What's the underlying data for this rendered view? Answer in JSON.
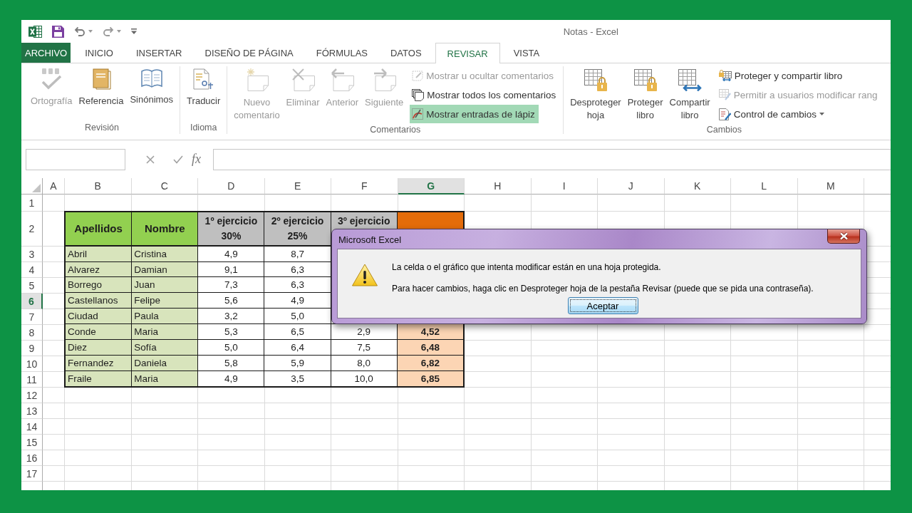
{
  "window": {
    "title": "Notas - Excel"
  },
  "tabs": [
    {
      "label": "ARCHIVO",
      "kind": "backstage",
      "selected": false
    },
    {
      "label": "INICIO",
      "kind": "tab",
      "selected": false
    },
    {
      "label": "INSERTAR",
      "kind": "tab",
      "selected": false
    },
    {
      "label": "DISEÑO DE PÁGINA",
      "kind": "tab",
      "selected": false
    },
    {
      "label": "FÓRMULAS",
      "kind": "tab",
      "selected": false
    },
    {
      "label": "DATOS",
      "kind": "tab",
      "selected": false
    },
    {
      "label": "REVISAR",
      "kind": "tab",
      "selected": true
    },
    {
      "label": "VISTA",
      "kind": "tab",
      "selected": false
    }
  ],
  "ribbon": {
    "groups": [
      {
        "label": "Revisión",
        "large": [
          {
            "label": "Ortografía",
            "disabled": true
          },
          {
            "label": "Referencia",
            "disabled": false
          },
          {
            "label": "Sinónimos",
            "disabled": false
          }
        ]
      },
      {
        "label": "Idioma",
        "large": [
          {
            "label": "Traducir",
            "disabled": false
          }
        ]
      },
      {
        "label": "Comentarios",
        "large": [
          {
            "label": "Nuevo comentario",
            "disabled": true
          },
          {
            "label": "Eliminar",
            "disabled": true
          },
          {
            "label": "Anterior",
            "disabled": true
          },
          {
            "label": "Siguiente",
            "disabled": true
          }
        ],
        "small": [
          {
            "kind": "button",
            "label": "Mostrar u ocultar comentarios",
            "disabled": true,
            "on": false
          },
          {
            "kind": "button",
            "label": "Mostrar todos los comentarios",
            "disabled": false,
            "on": false
          },
          {
            "kind": "button",
            "label": "Mostrar entradas de lápiz",
            "disabled": false,
            "on": true
          }
        ]
      },
      {
        "label": "Cambios",
        "large": [
          {
            "label": "Desproteger hoja",
            "disabled": false
          },
          {
            "label": "Proteger libro",
            "disabled": false
          },
          {
            "label": "Compartir libro",
            "disabled": false
          }
        ],
        "small": [
          {
            "kind": "button",
            "label": "Proteger y compartir libro",
            "disabled": false,
            "on": false
          },
          {
            "kind": "button",
            "label": "Permitir a usuarios modificar rang",
            "disabled": true,
            "on": false
          },
          {
            "kind": "menu",
            "label": "Control de cambios",
            "disabled": false,
            "on": false
          }
        ]
      }
    ]
  },
  "formula_bar": {
    "function_button": "fx"
  },
  "sheet": {
    "columns": [
      {
        "label": "A",
        "selected": false
      },
      {
        "label": "B",
        "selected": false
      },
      {
        "label": "C",
        "selected": false
      },
      {
        "label": "D",
        "selected": false
      },
      {
        "label": "E",
        "selected": false
      },
      {
        "label": "F",
        "selected": false
      },
      {
        "label": "G",
        "selected": true
      },
      {
        "label": "H",
        "selected": false
      },
      {
        "label": "I",
        "selected": false
      },
      {
        "label": "J",
        "selected": false
      },
      {
        "label": "K",
        "selected": false
      },
      {
        "label": "L",
        "selected": false
      },
      {
        "label": "M",
        "selected": false
      }
    ],
    "rows": [
      {
        "label": "1",
        "selected": false
      },
      {
        "label": "2",
        "selected": false
      },
      {
        "label": "3",
        "selected": false
      },
      {
        "label": "4",
        "selected": false
      },
      {
        "label": "5",
        "selected": false
      },
      {
        "label": "6",
        "selected": true
      },
      {
        "label": "7",
        "selected": false
      },
      {
        "label": "8",
        "selected": false
      },
      {
        "label": "9",
        "selected": false
      },
      {
        "label": "10",
        "selected": false
      },
      {
        "label": "11",
        "selected": false
      },
      {
        "label": "12",
        "selected": false
      },
      {
        "label": "13",
        "selected": false
      },
      {
        "label": "14",
        "selected": false
      },
      {
        "label": "15",
        "selected": false
      },
      {
        "label": "16",
        "selected": false
      },
      {
        "label": "17",
        "selected": false
      }
    ],
    "table": {
      "header": [
        {
          "kind": "name",
          "text": "Apellidos"
        },
        {
          "kind": "name",
          "text": "Nombre"
        },
        {
          "kind": "score",
          "text": "1º ejercicio",
          "weight": "30%"
        },
        {
          "kind": "score",
          "text": "2º ejercicio",
          "weight": "25%"
        },
        {
          "kind": "score",
          "text": "3º ejercicio"
        },
        {
          "kind": "final"
        }
      ],
      "rows": [
        [
          {
            "kind": "name",
            "text": "Abril"
          },
          {
            "kind": "name",
            "text": "Cristina"
          },
          {
            "kind": "score",
            "text": "4,9"
          },
          {
            "kind": "score",
            "text": "8,7"
          }
        ],
        [
          {
            "kind": "name",
            "text": "Alvarez"
          },
          {
            "kind": "name",
            "text": "Damian"
          },
          {
            "kind": "score",
            "text": "9,1"
          },
          {
            "kind": "score",
            "text": "6,3"
          }
        ],
        [
          {
            "kind": "name",
            "text": "Borrego"
          },
          {
            "kind": "name",
            "text": "Juan"
          },
          {
            "kind": "score",
            "text": "7,3"
          },
          {
            "kind": "score",
            "text": "6,3"
          }
        ],
        [
          {
            "kind": "name",
            "text": "Castellanos"
          },
          {
            "kind": "name",
            "text": "Felipe"
          },
          {
            "kind": "score",
            "text": "5,6"
          },
          {
            "kind": "score",
            "text": "4,9"
          }
        ],
        [
          {
            "kind": "name",
            "text": "Ciudad"
          },
          {
            "kind": "name",
            "text": "Paula"
          },
          {
            "kind": "score",
            "text": "3,2"
          },
          {
            "kind": "score",
            "text": "5,0"
          }
        ],
        [
          {
            "kind": "name",
            "text": "Conde"
          },
          {
            "kind": "name",
            "text": "Maria"
          },
          {
            "kind": "score",
            "text": "5,3"
          },
          {
            "kind": "score",
            "text": "6,5"
          },
          {
            "kind": "score",
            "text": "2,9"
          },
          {
            "kind": "final",
            "text": "4,52"
          }
        ],
        [
          {
            "kind": "name",
            "text": "Diez"
          },
          {
            "kind": "name",
            "text": "Sofía"
          },
          {
            "kind": "score",
            "text": "5,0"
          },
          {
            "kind": "score",
            "text": "6,4"
          },
          {
            "kind": "score",
            "text": "7,5"
          },
          {
            "kind": "final",
            "text": "6,48"
          }
        ],
        [
          {
            "kind": "name",
            "text": "Fernandez"
          },
          {
            "kind": "name",
            "text": "Daniela"
          },
          {
            "kind": "score",
            "text": "5,8"
          },
          {
            "kind": "score",
            "text": "5,9"
          },
          {
            "kind": "score",
            "text": "8,0"
          },
          {
            "kind": "final",
            "text": "6,82"
          }
        ],
        [
          {
            "kind": "name",
            "text": "Fraile"
          },
          {
            "kind": "name",
            "text": "Maria"
          },
          {
            "kind": "score",
            "text": "4,9"
          },
          {
            "kind": "score",
            "text": "3,5"
          },
          {
            "kind": "score",
            "text": "10,0"
          },
          {
            "kind": "final",
            "text": "6,85"
          }
        ]
      ]
    }
  },
  "dialog": {
    "title": "Microsoft Excel",
    "messages": [
      "La celda o el gráfico que intenta modificar están en una hoja protegida.",
      "Para hacer cambios, haga clic en Desproteger hoja de la pestaña Revisar (puede que se pida una contraseña)."
    ],
    "buttons": [
      {
        "label": "Aceptar",
        "focused": true
      }
    ]
  }
}
